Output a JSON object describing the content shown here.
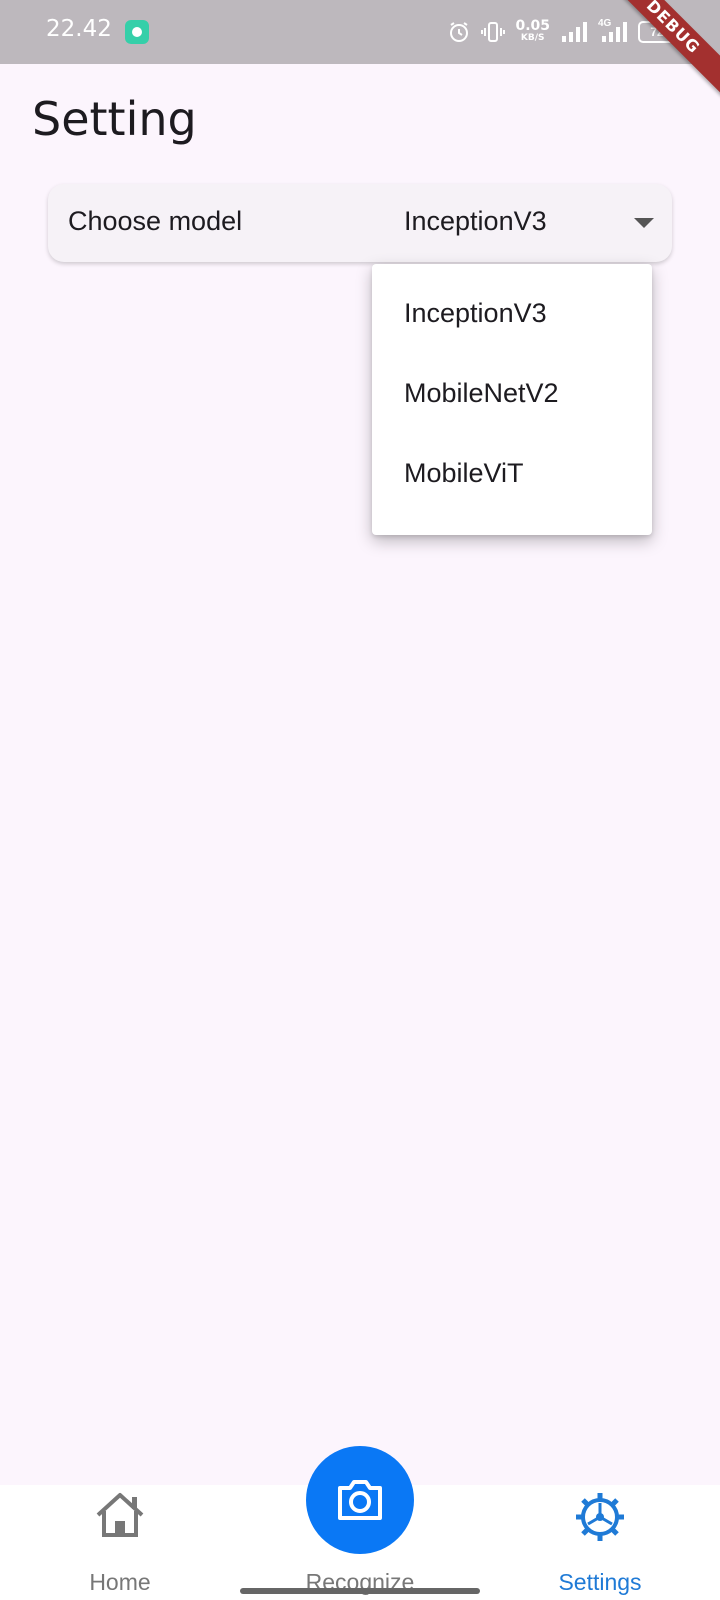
{
  "status_bar": {
    "time": "22.42",
    "net_speed": "0.05",
    "net_unit": "KB/S",
    "network_type": "4G",
    "battery": "72",
    "icons": [
      "app-notification-icon",
      "alarm-icon",
      "vibrate-icon",
      "signal-icon",
      "signal-4g-icon",
      "battery-icon"
    ]
  },
  "debug_banner": "DEBUG",
  "page": {
    "title": "Setting"
  },
  "model_setting": {
    "label": "Choose model",
    "selected": "InceptionV3",
    "options": [
      "InceptionV3",
      "MobileNetV2",
      "MobileViT"
    ]
  },
  "bottom_nav": {
    "items": [
      {
        "label": "Home",
        "icon": "home-icon",
        "active": false
      },
      {
        "label": "Recognize",
        "icon": "camera-icon",
        "active": false
      },
      {
        "label": "Settings",
        "icon": "settings-icon",
        "active": true
      }
    ]
  },
  "colors": {
    "background": "#fcf5fd",
    "accent": "#0a78f5",
    "active_nav": "#1f7ad6",
    "debug_banner": "#a3302f",
    "status_bar": "#bdb8bd"
  }
}
